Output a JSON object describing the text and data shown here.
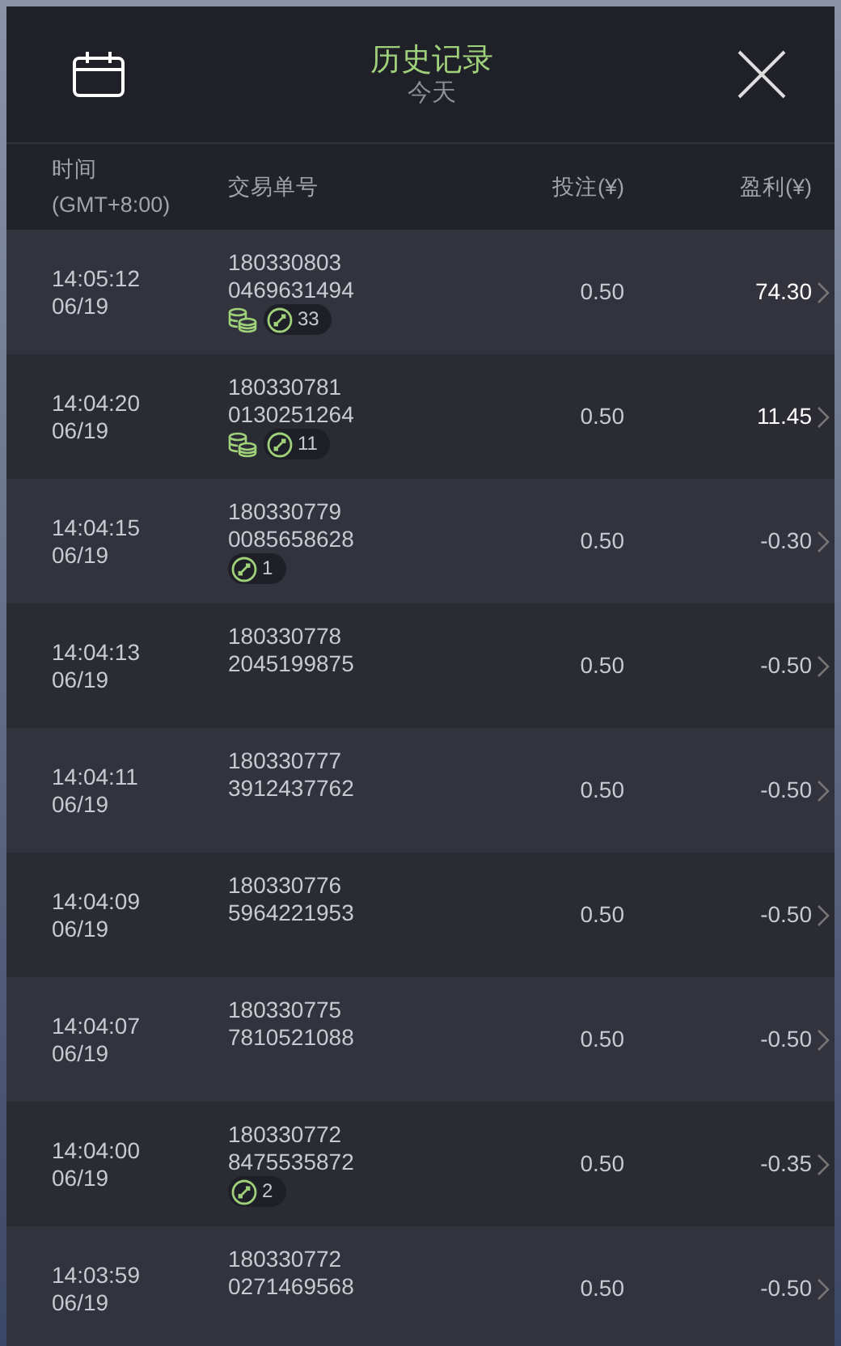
{
  "header": {
    "title": "历史记录",
    "subtitle": "今天"
  },
  "columns": {
    "time": [
      "时间",
      "(GMT+8:00)"
    ],
    "order": "交易单号",
    "bet": "投注(¥)",
    "profit": "盈利(¥)"
  },
  "rows": [
    {
      "time": "14:05:12",
      "date": "06/19",
      "order": [
        "180330803",
        "0469631494"
      ],
      "coins": true,
      "spins": "33",
      "bet": "0.50",
      "profit": "74.30",
      "win": true
    },
    {
      "time": "14:04:20",
      "date": "06/19",
      "order": [
        "180330781",
        "0130251264"
      ],
      "coins": true,
      "spins": "11",
      "bet": "0.50",
      "profit": "11.45",
      "win": true
    },
    {
      "time": "14:04:15",
      "date": "06/19",
      "order": [
        "180330779",
        "0085658628"
      ],
      "coins": false,
      "spins": "1",
      "bet": "0.50",
      "profit": "-0.30",
      "win": false
    },
    {
      "time": "14:04:13",
      "date": "06/19",
      "order": [
        "180330778",
        "2045199875"
      ],
      "coins": false,
      "bet": "0.50",
      "profit": "-0.50",
      "win": false
    },
    {
      "time": "14:04:11",
      "date": "06/19",
      "order": [
        "180330777",
        "3912437762"
      ],
      "coins": false,
      "bet": "0.50",
      "profit": "-0.50",
      "win": false
    },
    {
      "time": "14:04:09",
      "date": "06/19",
      "order": [
        "180330776",
        "5964221953"
      ],
      "coins": false,
      "bet": "0.50",
      "profit": "-0.50",
      "win": false
    },
    {
      "time": "14:04:07",
      "date": "06/19",
      "order": [
        "180330775",
        "7810521088"
      ],
      "coins": false,
      "bet": "0.50",
      "profit": "-0.50",
      "win": false
    },
    {
      "time": "14:04:00",
      "date": "06/19",
      "order": [
        "180330772",
        "8475535872"
      ],
      "coins": false,
      "spins": "2",
      "bet": "0.50",
      "profit": "-0.35",
      "win": false
    },
    {
      "time": "14:03:59",
      "date": "06/19",
      "order": [
        "180330772",
        "0271469568"
      ],
      "coins": false,
      "bet": "0.50",
      "profit": "-0.50",
      "win": false
    }
  ]
}
